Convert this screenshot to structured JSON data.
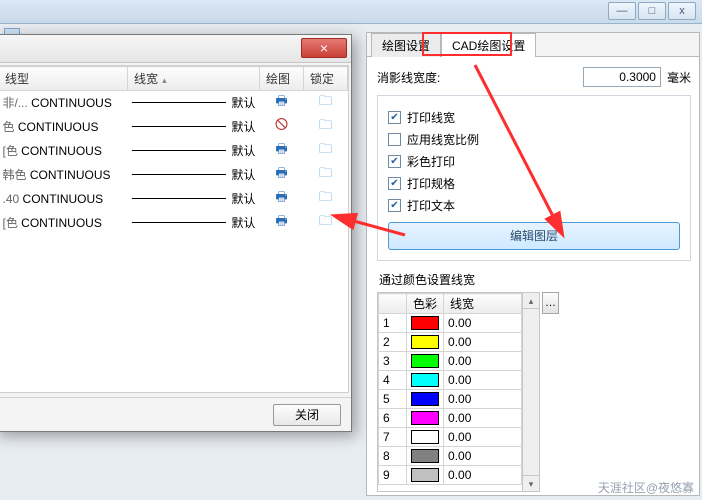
{
  "window_controls": {
    "min": "—",
    "max": "□",
    "close": "x"
  },
  "left": {
    "close_glyph": "×",
    "headers": {
      "linetype": "线型",
      "lineweight": "线宽",
      "plot": "绘图",
      "lock": "锁定"
    },
    "default_label": "默认",
    "rows": [
      {
        "type_prefix": "非/...",
        "type": "CONTINUOUS",
        "plot_ok": true
      },
      {
        "type_prefix": "色",
        "type": "CONTINUOUS",
        "plot_ok": false
      },
      {
        "type_prefix": "[色",
        "type": "CONTINUOUS",
        "plot_ok": true
      },
      {
        "type_prefix": "韩色",
        "type": "CONTINUOUS",
        "plot_ok": true
      },
      {
        "type_prefix": ".40",
        "type": "CONTINUOUS",
        "plot_ok": true
      },
      {
        "type_prefix": "[色",
        "type": "CONTINUOUS",
        "plot_ok": true
      }
    ],
    "close_btn": "关闭"
  },
  "right": {
    "tabs": {
      "t1": "绘图设置",
      "t2": "CAD绘图设置"
    },
    "hidden_line_label": "消影线宽度:",
    "hidden_line_value": "0.3000",
    "unit": "毫米",
    "checks": {
      "print_lw": {
        "label": "打印线宽",
        "checked": true
      },
      "apply_scale": {
        "label": "应用线宽比例",
        "checked": false
      },
      "color_print": {
        "label": "彩色打印",
        "checked": true
      },
      "print_spec": {
        "label": "打印规格",
        "checked": true
      },
      "print_text": {
        "label": "打印文本",
        "checked": true
      }
    },
    "edit_layers": "编辑图层",
    "by_color_label": "通过颜色设置线宽",
    "color_headers": {
      "color": "色彩",
      "lw": "线宽"
    },
    "color_rows": [
      {
        "idx": "1",
        "color": "#ff0000",
        "lw": "0.00"
      },
      {
        "idx": "2",
        "color": "#ffff00",
        "lw": "0.00"
      },
      {
        "idx": "3",
        "color": "#00ff00",
        "lw": "0.00"
      },
      {
        "idx": "4",
        "color": "#00ffff",
        "lw": "0.00"
      },
      {
        "idx": "5",
        "color": "#0000ff",
        "lw": "0.00"
      },
      {
        "idx": "6",
        "color": "#ff00ff",
        "lw": "0.00"
      },
      {
        "idx": "7",
        "color": "#ffffff",
        "lw": "0.00"
      },
      {
        "idx": "8",
        "color": "#808080",
        "lw": "0.00"
      },
      {
        "idx": "9",
        "color": "#c0c0c0",
        "lw": "0.00"
      }
    ],
    "side_btn": "…"
  },
  "watermark": "天涯社区@夜悠寡"
}
